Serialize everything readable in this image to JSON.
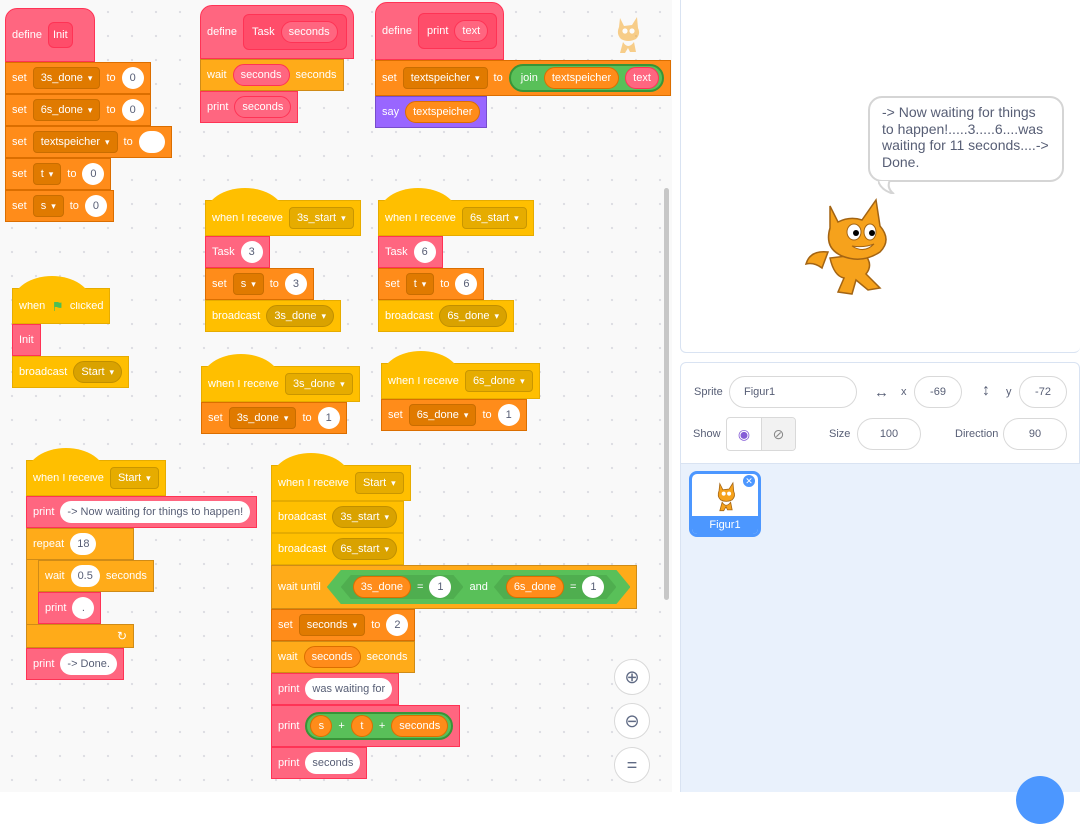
{
  "scripts": {
    "init_def": {
      "define": "define",
      "name": "Init",
      "rows": [
        {
          "op": "set",
          "var": "3s_done",
          "to": "to",
          "val": "0"
        },
        {
          "op": "set",
          "var": "6s_done",
          "to": "to",
          "val": "0"
        },
        {
          "op": "set",
          "var": "textspeicher",
          "to": "to",
          "val": ""
        },
        {
          "op": "set",
          "var": "t",
          "to": "to",
          "val": "0"
        },
        {
          "op": "set",
          "var": "s",
          "to": "to",
          "val": "0"
        }
      ]
    },
    "task_def": {
      "define": "define",
      "name": "Task",
      "arg": "seconds",
      "wait": "wait",
      "wait_arg": "seconds",
      "wait_unit": "seconds",
      "print": "print",
      "print_arg": "seconds"
    },
    "print_def": {
      "define": "define",
      "name": "print",
      "arg": "text",
      "set": "set",
      "var": "textspeicher",
      "to": "to",
      "join": "join",
      "join_a": "textspeicher",
      "join_b": "text",
      "say": "say",
      "say_arg": "textspeicher"
    },
    "flag": {
      "when": "when",
      "clicked": "clicked",
      "init": "Init",
      "broadcast": "broadcast",
      "msg": "Start"
    },
    "recv3s": {
      "when": "when I receive",
      "msg": "3s_start",
      "task": "Task",
      "task_val": "3",
      "set": "set",
      "var": "s",
      "to": "to",
      "val": "3",
      "broadcast": "broadcast",
      "bmsg": "3s_done"
    },
    "recv6s": {
      "when": "when I receive",
      "msg": "6s_start",
      "task": "Task",
      "task_val": "6",
      "set": "set",
      "var": "t",
      "to": "to",
      "val": "6",
      "broadcast": "broadcast",
      "bmsg": "6s_done"
    },
    "recv3done": {
      "when": "when I receive",
      "msg": "3s_done",
      "set": "set",
      "var": "3s_done",
      "to": "to",
      "val": "1"
    },
    "recv6done": {
      "when": "when I receive",
      "msg": "6s_done",
      "set": "set",
      "var": "6s_done",
      "to": "to",
      "val": "1"
    },
    "recvStartA": {
      "when": "when I receive",
      "msg": "Start",
      "print": "print",
      "print_val": "-> Now waiting for things to happen!",
      "repeat": "repeat",
      "repeat_val": "18",
      "wait": "wait",
      "wait_val": "0.5",
      "wait_unit": "seconds",
      "print2": "print",
      "print2_val": ".",
      "print3": "print",
      "print3_val": "-> Done."
    },
    "recvStartB": {
      "when": "when I receive",
      "msg": "Start",
      "b1": "broadcast",
      "b1msg": "3s_start",
      "b2": "broadcast",
      "b2msg": "6s_start",
      "waituntil": "wait until",
      "c1var": "3s_done",
      "eq": "=",
      "c1val": "1",
      "and": "and",
      "c2var": "6s_done",
      "c2val": "1",
      "set": "set",
      "var": "seconds",
      "to": "to",
      "val": "2",
      "wait": "wait",
      "wait_arg": "seconds",
      "wait_unit": "seconds",
      "p1": "print",
      "p1val": "was waiting for",
      "p2": "print",
      "p2a": "s",
      "plus": "+",
      "p2b": "t",
      "p2c": "seconds",
      "p3": "print",
      "p3val": "seconds"
    }
  },
  "stage": {
    "bubble": "-> Now waiting for things to happen!.....3.....6....was waiting for 11 seconds....-> Done."
  },
  "sprite_info": {
    "sprite_label": "Sprite",
    "sprite_name": "Figur1",
    "x_label": "x",
    "x": "-69",
    "y_label": "y",
    "y": "-72",
    "show_label": "Show",
    "size_label": "Size",
    "size": "100",
    "direction_label": "Direction",
    "direction": "90"
  },
  "sprites": [
    {
      "name": "Figur1"
    }
  ],
  "icons": {
    "zoom_in": "zoom-in-icon",
    "zoom_out": "zoom-out-icon",
    "zoom_reset": "zoom-reset-icon",
    "flag": "green-flag-icon"
  },
  "colors": {
    "events": "#ffbf00",
    "variables": "#ff8c1a",
    "control": "#ffab19",
    "custom": "#ff6680",
    "looks": "#9966ff",
    "operators": "#59c059",
    "accent": "#4c97ff"
  }
}
